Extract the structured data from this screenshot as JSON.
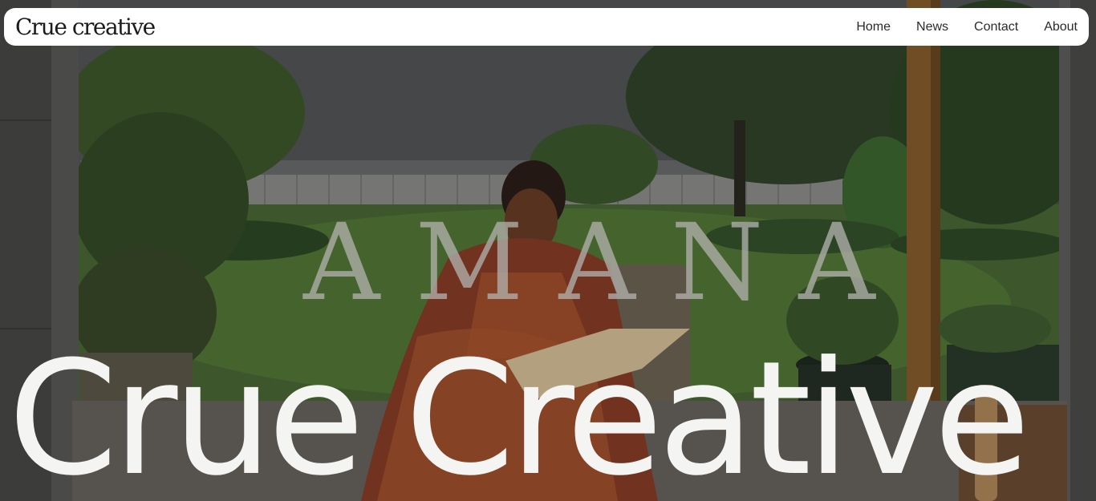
{
  "header": {
    "logo_text": "Crue creative",
    "nav": [
      {
        "label": "Home"
      },
      {
        "label": "News"
      },
      {
        "label": "Contact"
      },
      {
        "label": "About"
      }
    ]
  },
  "hero": {
    "background_watermark": "AMANA",
    "title": "Crue Creative"
  },
  "colors": {
    "navbar_bg": "#ffffff",
    "nav_text": "#2b2b2b",
    "hero_title": "#f4f4f2"
  }
}
